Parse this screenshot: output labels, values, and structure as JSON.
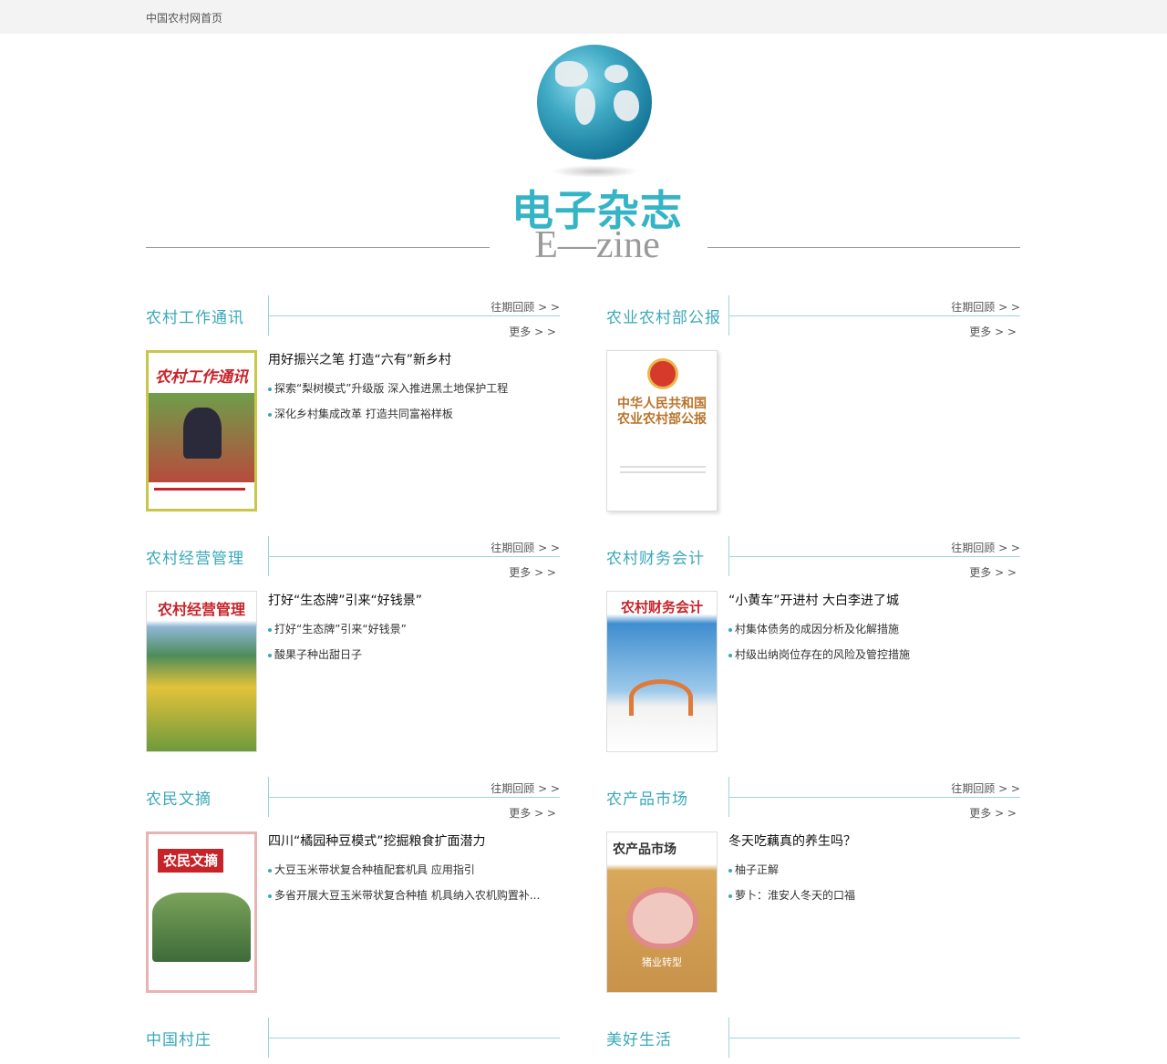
{
  "topbar": {
    "home_link": "中国农村网首页"
  },
  "hero": {
    "title_cn": "电子杂志",
    "title_en": "E—zine"
  },
  "labels": {
    "past": "往期回顾 > >",
    "more": "更多 > >"
  },
  "sections": [
    {
      "title": "农村工作通讯",
      "headline": "用好振兴之笔 打造“六有”新乡村",
      "items": [
        "探索“梨树模式”升级版 深入推进黑土地保护工程",
        "深化乡村集成改革 打造共同富裕样板"
      ],
      "cover_title": "农村工作通讯"
    },
    {
      "title": "农业农村部公报",
      "headline": "",
      "items": [],
      "cover_title": "中华人民共和国农业农村部公报"
    },
    {
      "title": "农村经营管理",
      "headline": "打好“生态牌”引来“好钱景”",
      "items": [
        "打好“生态牌”引来“好钱景”",
        "酸果子种出甜日子"
      ],
      "cover_title": "农村经营管理"
    },
    {
      "title": "农村财务会计",
      "headline": "“小黄车”开进村 大白李进了城",
      "items": [
        "村集体债务的成因分析及化解措施",
        "村级出纳岗位存在的风险及管控措施"
      ],
      "cover_title": "农村财务会计"
    },
    {
      "title": "农民文摘",
      "headline": "四川“橘园种豆模式”挖掘粮食扩面潜力",
      "items": [
        "大豆玉米带状复合种植配套机具 应用指引",
        "多省开展大豆玉米带状复合种植 机具纳入农机购置补..."
      ],
      "cover_title": "农民文摘"
    },
    {
      "title": "农产品市场",
      "headline": "冬天吃藕真的养生吗？",
      "items": [
        "柚子正解",
        "萝卜：淮安人冬天的口福"
      ],
      "cover_title": "农产品市场",
      "cover_subtitle": "猪业转型"
    },
    {
      "title": "中国村庄"
    },
    {
      "title": "美好生活"
    }
  ]
}
